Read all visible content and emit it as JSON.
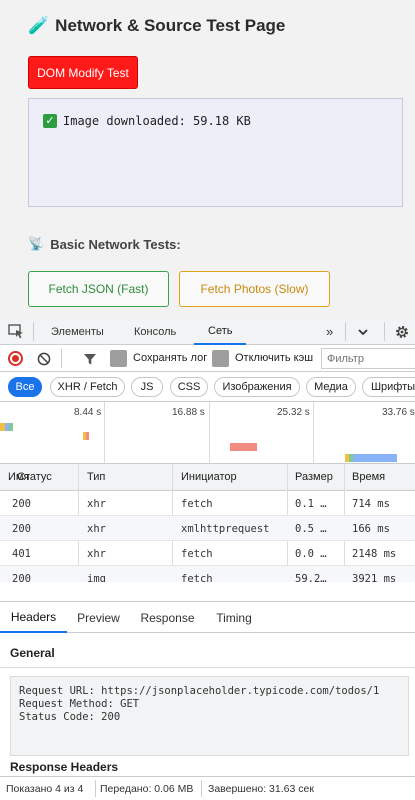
{
  "page": {
    "title": "Network & Source Test Page",
    "title_icon": "test-tube-icon",
    "dom_button": "DOM Modify Test",
    "log_line": "Image downloaded: 59.18 KB",
    "section_title": "Basic Network Tests:",
    "section_icon": "satellite-antenna-icon",
    "fetch_json_button": "Fetch JSON (Fast)",
    "fetch_photos_button": "Fetch Photos (Slow)"
  },
  "devtools": {
    "tabs": [
      "Элементы",
      "Консоль",
      "Сеть"
    ],
    "active_tab": "Сеть",
    "more_tabs": "»",
    "toolbar": {
      "preserve_log": "Сохранять лог",
      "disable_cache": "Отключить кэш",
      "filter_placeholder": "Фильтр"
    },
    "chips": [
      "Все",
      "XHR / Fetch",
      "JS",
      "CSS",
      "Изображения",
      "Медиа",
      "Шрифты"
    ],
    "overview_ticks": [
      "8.44 s",
      "16.88 s",
      "25.32 s",
      "33.76 s"
    ],
    "grid": {
      "headers": [
        "Имя",
        "Статус",
        "Тип",
        "Инициатор",
        "Размер",
        "Время"
      ],
      "rows": [
        {
          "status": "200",
          "type": "xhr",
          "initiator": "fetch",
          "size": "0.1 …",
          "time": "714 ms"
        },
        {
          "status": "200",
          "type": "xhr",
          "initiator": "xmlhttprequest",
          "size": "0.5 …",
          "time": "166 ms"
        },
        {
          "status": "401",
          "type": "xhr",
          "initiator": "fetch",
          "size": "0.0 …",
          "time": "2148 ms"
        },
        {
          "status": "200",
          "type": "img",
          "initiator": "fetch",
          "size": "59.2…",
          "time": "3921 ms"
        }
      ]
    },
    "detail_tabs": [
      "Headers",
      "Preview",
      "Response",
      "Timing"
    ],
    "active_detail_tab": "Headers",
    "general": {
      "title": "General",
      "text": "Request URL: https://jsonplaceholder.typicode.com/todos/1\nRequest Method: GET\nStatus Code: 200"
    },
    "response_headers_title": "Response Headers",
    "status_bar": {
      "shown": "Показано 4 из 4",
      "transferred": "Передано: 0.06 MB",
      "finished": "Завершено: 31.63 сек"
    }
  },
  "colors": {
    "dom_button": "#ff1a1a",
    "accent": "#1a73e8",
    "fetch_json_border": "#3aa34a",
    "fetch_photos_border": "#e0a21a",
    "record": "#d93025"
  }
}
